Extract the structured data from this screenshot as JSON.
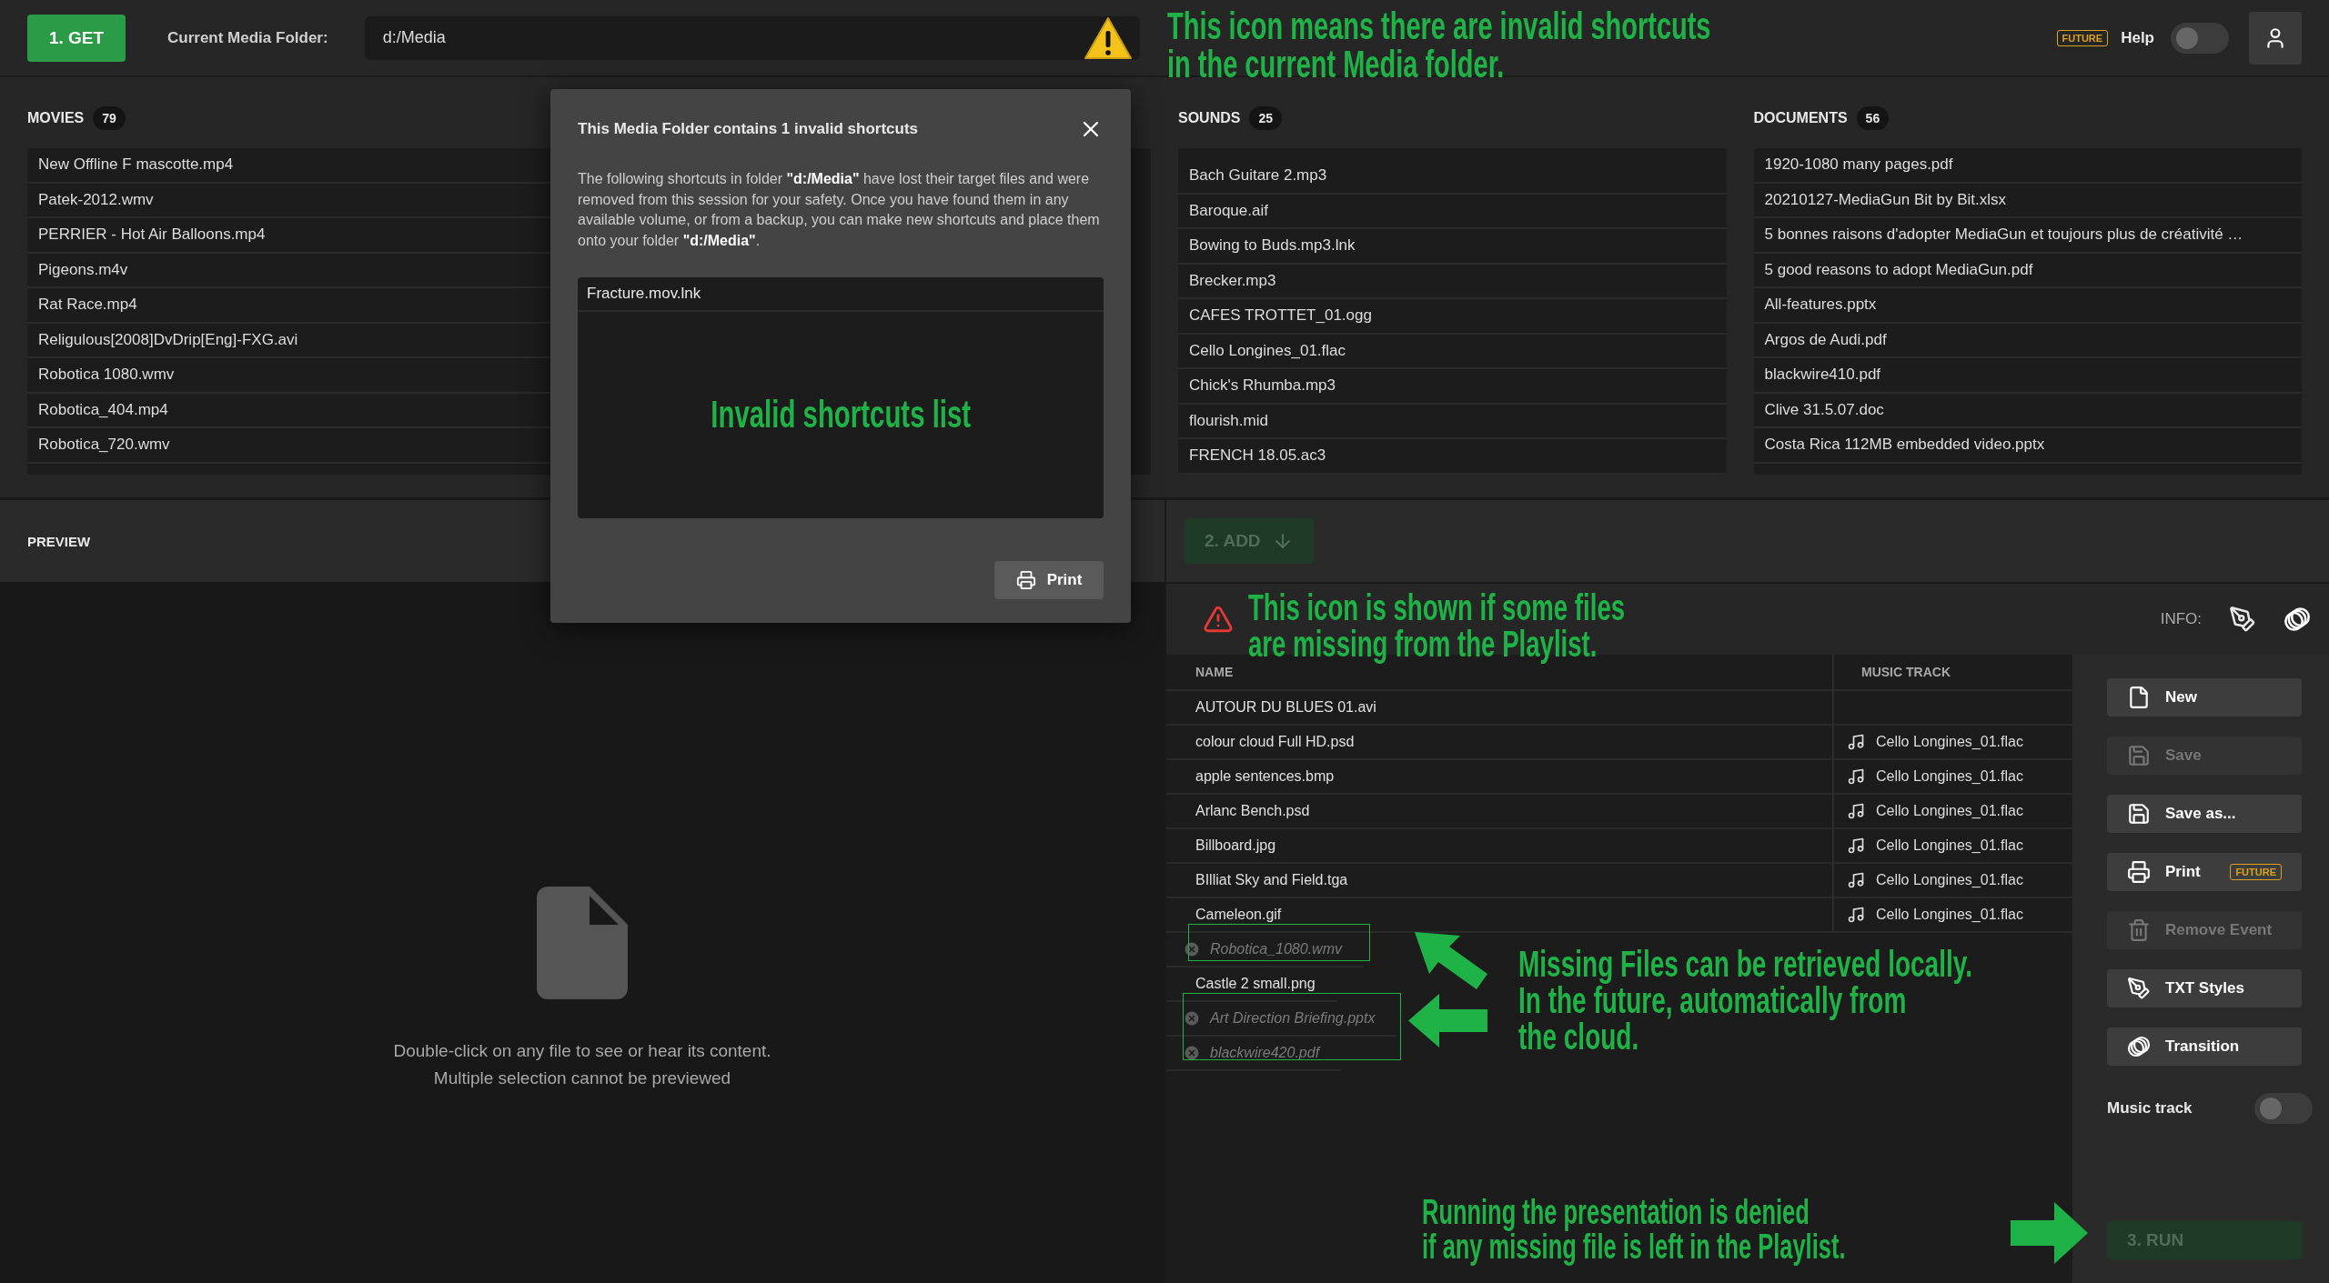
{
  "top_bar": {
    "get_button": "1. GET",
    "folder_label": "Current Media Folder:",
    "folder_path": "d:/Media",
    "invalid_shortcuts_warning": true,
    "future_badge": "FUTURE",
    "help_label": "Help",
    "help_on": false
  },
  "browser": {
    "columns": [
      {
        "title": "MOVIES",
        "count": "79",
        "items": [
          "New Offline F mascotte.mp4",
          "Patek-2012.wmv",
          "PERRIER - Hot Air Balloons.mp4",
          "Pigeons.m4v",
          "Rat Race.mp4",
          "Religulous[2008]DvDrip[Eng]-FXG.avi",
          "Robotica 1080.wmv",
          "Robotica_404.mp4",
          "Robotica_720.wmv"
        ]
      },
      {
        "title": "SOUNDS",
        "count": "25",
        "items": [
          "Bach Guitare 2.mp3",
          "Baroque.aif",
          "Bowing to Buds.mp3.lnk",
          "Brecker.mp3",
          "CAFES TROTTET_01.ogg",
          "Cello Longines_01.flac",
          "Chick's Rhumba.mp3",
          "flourish.mid",
          "FRENCH 18.05.ac3"
        ]
      },
      {
        "title": "DOCUMENTS",
        "count": "56",
        "items": [
          "1920-1080 many pages.pdf",
          "20210127-MediaGun Bit by Bit.xlsx",
          "5 bonnes raisons d'adopter MediaGun et toujours plus de créativité …",
          "5 good reasons to adopt MediaGun.pdf",
          "All-features.pptx",
          "Argos de Audi.pdf",
          "blackwire410.pdf",
          "Clive 31.5.07.doc",
          "Costa Rica 112MB embedded video.pptx"
        ]
      }
    ]
  },
  "preview": {
    "title": "PREVIEW",
    "message_lines": [
      "Double-click on any file to see or hear its content.",
      "Multiple selection cannot be previewed"
    ]
  },
  "playlist": {
    "add_button": {
      "label": "2. ADD",
      "disabled": true
    },
    "missing_files_warning": true,
    "info_label": "INFO:",
    "columns": [
      "NAME",
      "MUSIC TRACK"
    ],
    "rows": [
      {
        "name": "AUTOUR DU BLUES 01.avi",
        "missing": false
      },
      {
        "name": "colour cloud Full HD.psd",
        "music_track": "Cello Longines_01.flac",
        "missing": false
      },
      {
        "name": "apple sentences.bmp",
        "music_track": "Cello Longines_01.flac",
        "missing": false
      },
      {
        "name": "Arlanc Bench.psd",
        "music_track": "Cello Longines_01.flac",
        "missing": false
      },
      {
        "name": "Billboard.jpg",
        "music_track": "Cello Longines_01.flac",
        "missing": false
      },
      {
        "name": "BIlliat Sky and Field.tga",
        "music_track": "Cello Longines_01.flac",
        "missing": false
      },
      {
        "name": "Cameleon.gif",
        "music_track": "Cello Longines_01.flac",
        "missing": false
      },
      {
        "name": "Robotica_1080.wmv",
        "missing": true
      },
      {
        "name": "Castle 2 small.png",
        "missing": false
      },
      {
        "name": "Art Direction Briefing.pptx",
        "missing": true
      },
      {
        "name": "blackwire420.pdf",
        "missing": true
      }
    ],
    "actions": [
      {
        "label": "New",
        "kind": "new",
        "disabled": false
      },
      {
        "label": "Save",
        "kind": "save",
        "disabled": true
      },
      {
        "label": "Save as...",
        "kind": "save",
        "disabled": false
      },
      {
        "label": "Print",
        "kind": "print",
        "disabled": false,
        "badge": "FUTURE"
      },
      {
        "label": "Remove Event",
        "kind": "remove",
        "disabled": true
      },
      {
        "label": "TXT Styles",
        "kind": "styles",
        "disabled": false
      },
      {
        "label": "Transition",
        "kind": "transition",
        "disabled": false
      }
    ],
    "music_track": {
      "label": "Music track",
      "on": false
    },
    "run_button": {
      "label": "3. RUN",
      "disabled": true
    }
  },
  "dialog": {
    "title": "This Media Folder contains 1 invalid shortcuts",
    "message": "The following shortcuts in folder **\"d:/Media\"** have lost their target files and were removed from this session for your safety. Once you have found them in any available volume, or from a backup, you can make new shortcuts and place them onto your folder **\"d:/Media\"**.",
    "items": [
      "Fracture.mov.lnk"
    ],
    "list_annotation": "Invalid shortcuts list",
    "print_button": "Print"
  },
  "annotations": [
    {
      "text": "This icon means there are invalid shortcuts\nin the current Media folder."
    },
    {
      "text": "This icon is shown if some files\nare missing from the Playlist."
    },
    {
      "text": "Missing Files can be retrieved locally.\nIn the future, automatically from\nthe cloud."
    },
    {
      "text": "Running the presentation is denied\nif any missing file is left in the Playlist."
    }
  ]
}
